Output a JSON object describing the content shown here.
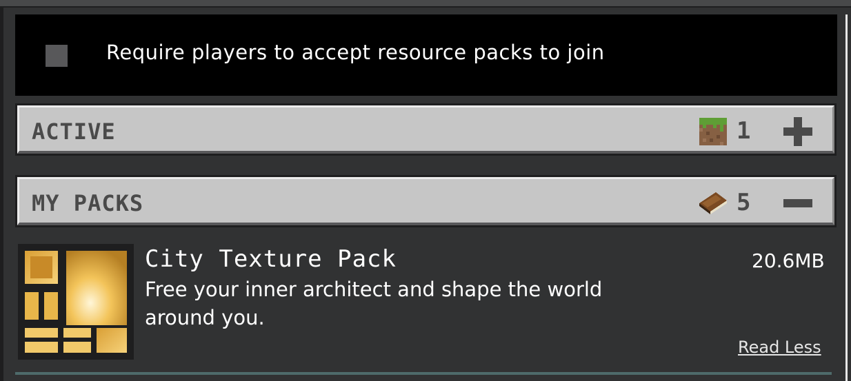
{
  "require_accept": {
    "label": "Require players to accept resource packs to join",
    "checked": false
  },
  "sections": {
    "active": {
      "title": "ACTIVE",
      "count": "1",
      "icon": "grass-block-icon",
      "toggle_icon": "plus-icon"
    },
    "my_packs": {
      "title": "MY PACKS",
      "count": "5",
      "icon": "book-icon",
      "toggle_icon": "minus-icon"
    }
  },
  "pack": {
    "title": "City Texture Pack",
    "size": "20.6MB",
    "description": "Free your inner architect and shape the world around you.",
    "read_less": "Read Less",
    "icon": "city-texture-pack-thumbnail"
  },
  "colors": {
    "background": "#313233",
    "section_bg": "#c6c6c6",
    "row_bg": "#000000",
    "text": "#ffffff"
  }
}
